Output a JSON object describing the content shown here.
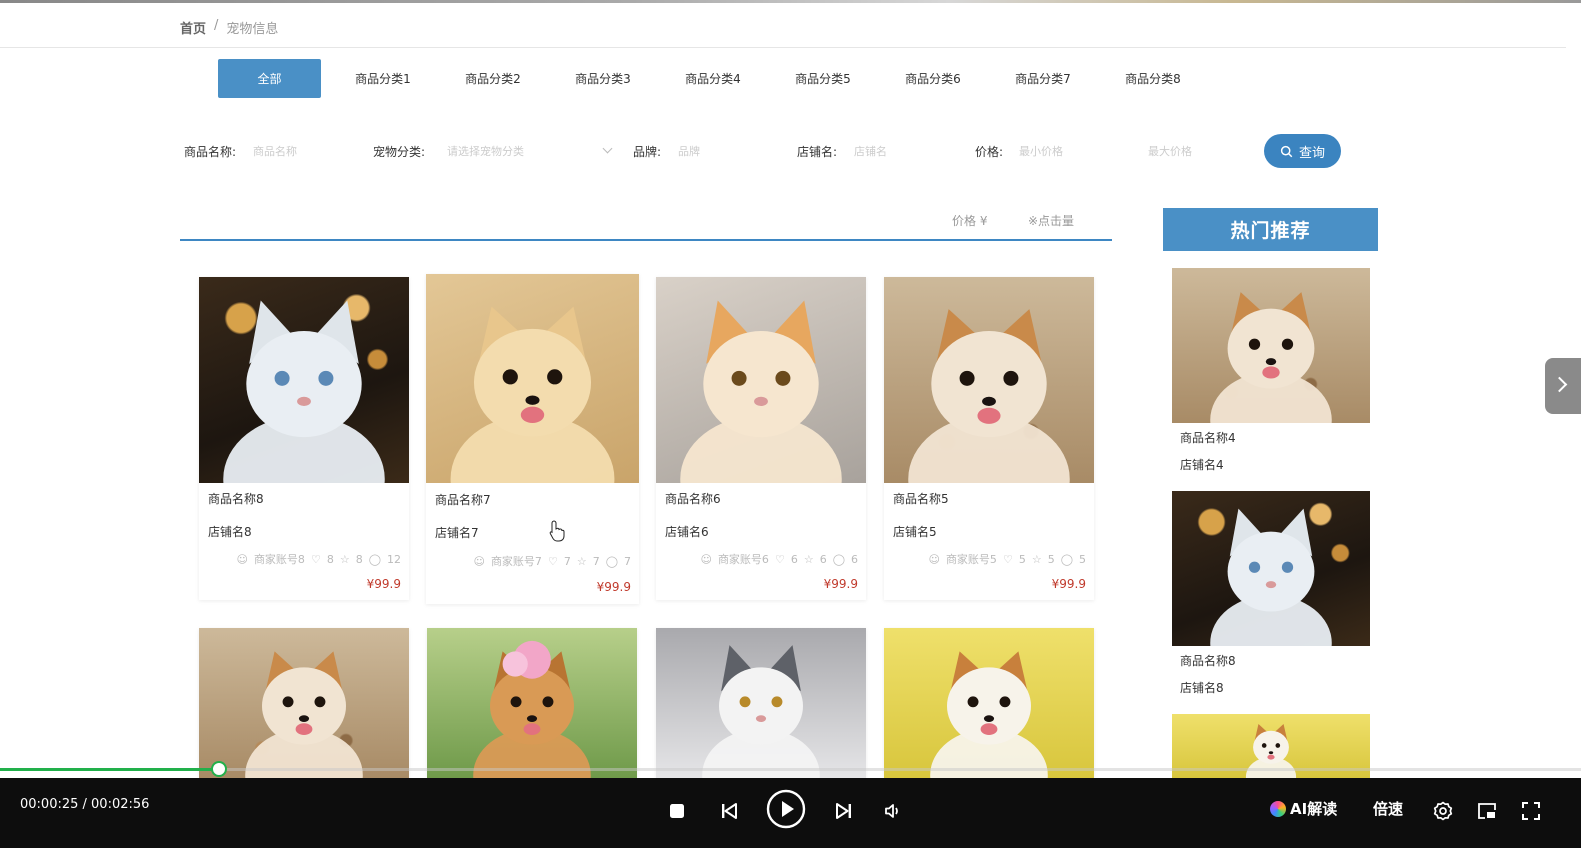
{
  "breadcrumb": {
    "home": "首页",
    "separator": "/",
    "current": "宠物信息"
  },
  "categories": [
    "全部",
    "商品分类1",
    "商品分类2",
    "商品分类3",
    "商品分类4",
    "商品分类5",
    "商品分类6",
    "商品分类7",
    "商品分类8"
  ],
  "filters": {
    "name_label": "商品名称:",
    "name_placeholder": "商品名称",
    "type_label": "宠物分类:",
    "type_placeholder": "请选择宠物分类",
    "brand_label": "品牌:",
    "brand_placeholder": "品牌",
    "shop_label": "店铺名:",
    "shop_placeholder": "店铺名",
    "price_label": "价格:",
    "price_min_placeholder": "最小价格",
    "price_max_placeholder": "最大价格",
    "search_label": "查询"
  },
  "sort": {
    "price": "价格 ¥",
    "clicks": "※点击量"
  },
  "products": [
    {
      "name": "商品名称8",
      "shop": "店铺名8",
      "account": "商家账号8",
      "likes": "8",
      "favs": "8",
      "views": "12",
      "price": "¥99.9",
      "pet": "cat-white"
    },
    {
      "name": "商品名称7",
      "shop": "店铺名7",
      "account": "商家账号7",
      "likes": "7",
      "favs": "7",
      "views": "7",
      "price": "¥99.9",
      "pet": "dog-pom"
    },
    {
      "name": "商品名称6",
      "shop": "店铺名6",
      "account": "商家账号6",
      "likes": "6",
      "favs": "6",
      "views": "6",
      "price": "¥99.9",
      "pet": "cat-orange"
    },
    {
      "name": "商品名称5",
      "shop": "店铺名5",
      "account": "商家账号5",
      "likes": "5",
      "favs": "5",
      "views": "5",
      "price": "¥99.9",
      "pet": "dog-akita"
    }
  ],
  "products_row2": [
    {
      "pet": "dog-akita"
    },
    {
      "pet": "dog-flower"
    },
    {
      "pet": "cat-grey"
    },
    {
      "pet": "dog-corgi"
    }
  ],
  "hot": {
    "title": "热门推荐",
    "items": [
      {
        "name": "商品名称4",
        "shop": "店铺名4",
        "pet": "dog-akita"
      },
      {
        "name": "商品名称8",
        "shop": "店铺名8",
        "pet": "cat-white"
      },
      {
        "pet": "dog-corgi"
      }
    ]
  },
  "player": {
    "time": "00:00:25 / 00:02:56",
    "ai_label": "AI解读",
    "speed_label": "倍速",
    "progress_fraction": 0.142
  }
}
